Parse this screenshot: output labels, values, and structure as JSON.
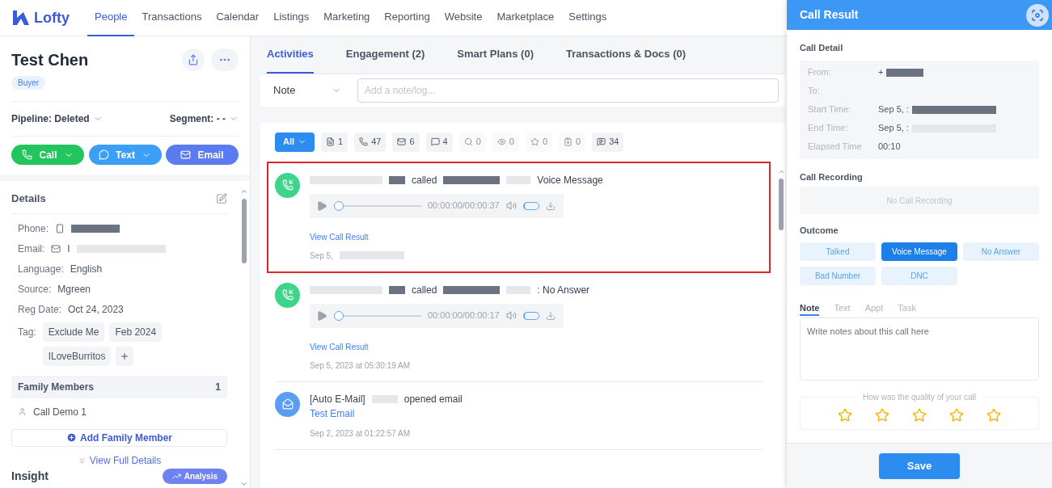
{
  "brand": "Lofty",
  "nav": [
    {
      "label": "People",
      "selected": true
    },
    {
      "label": "Transactions",
      "selected": false
    },
    {
      "label": "Calendar",
      "selected": false
    },
    {
      "label": "Listings",
      "selected": false
    },
    {
      "label": "Marketing",
      "selected": false
    },
    {
      "label": "Reporting",
      "selected": false
    },
    {
      "label": "Website",
      "selected": false
    },
    {
      "label": "Marketplace",
      "selected": false
    },
    {
      "label": "Settings",
      "selected": false
    }
  ],
  "contact": {
    "name": "Test Chen",
    "badge": "Buyer",
    "pipeline": "Pipeline: Deleted",
    "segment": "Segment: - -",
    "actions": [
      {
        "label": "Call",
        "kind": "call"
      },
      {
        "label": "Text",
        "kind": "text"
      },
      {
        "label": "Email",
        "kind": "email"
      }
    ]
  },
  "details": {
    "title": "Details",
    "fields": [
      {
        "label": "Phone:",
        "kind": "phone"
      },
      {
        "label": "Email:",
        "kind": "email",
        "value": "I"
      },
      {
        "label": "Language:",
        "kind": "plain",
        "value": "English"
      },
      {
        "label": "Source:",
        "kind": "plain",
        "value": "Mgreen"
      },
      {
        "label": "Reg Date:",
        "kind": "plain",
        "value": "Oct 24, 2023"
      }
    ],
    "tag_label": "Tag:",
    "tags": [
      "Exclude Me",
      "Feb 2024",
      "ILoveBurritos"
    ],
    "family_title": "Family Members",
    "family_count": "1",
    "family": [
      "Call Demo 1"
    ],
    "add_family": "Add Family Member",
    "view_full": "View Full Details"
  },
  "insight": {
    "title": "Insight",
    "button": "Analysis"
  },
  "tabs": [
    {
      "label": "Activities",
      "selected": true
    },
    {
      "label": "Engagement (2)",
      "selected": false
    },
    {
      "label": "Smart Plans (0)",
      "selected": false
    },
    {
      "label": "Transactions & Docs (0)",
      "selected": false
    }
  ],
  "note_bar": {
    "type": "Note",
    "placeholder": "Add a note/log..."
  },
  "filters": [
    {
      "kind": "all",
      "label": "All",
      "selected": true
    },
    {
      "kind": "note",
      "label": "1",
      "selected": false,
      "disabled": false
    },
    {
      "kind": "call",
      "label": "47",
      "selected": false,
      "disabled": false
    },
    {
      "kind": "email",
      "label": "6",
      "selected": false,
      "disabled": false
    },
    {
      "kind": "text",
      "label": "4",
      "selected": false,
      "disabled": false
    },
    {
      "kind": "search",
      "label": "0",
      "selected": false,
      "disabled": true
    },
    {
      "kind": "view",
      "label": "0",
      "selected": false,
      "disabled": true
    },
    {
      "kind": "favorite",
      "label": "0",
      "selected": false,
      "disabled": true
    },
    {
      "kind": "task",
      "label": "0",
      "selected": false,
      "disabled": true
    },
    {
      "kind": "chat",
      "label": "34",
      "selected": false,
      "disabled": false
    }
  ],
  "activities": [
    {
      "kind": "call",
      "highlighted": true,
      "verb": "called",
      "outcome": "Voice Message",
      "time": "00:00:00/00:00:37",
      "link": "View Call Result",
      "date": "Sep 5,",
      "level": 0
    },
    {
      "kind": "call",
      "highlighted": false,
      "verb": "called",
      "outcome": ": No Answer",
      "time": "00:00:00/00:00:17",
      "link": "View Call Result",
      "date": "Sep 5, 2023 at 05:30:19 AM",
      "level": 0
    },
    {
      "kind": "email",
      "highlighted": false,
      "prefix": "[Auto E-Mail]",
      "verb": "opened email",
      "link": "Test Email",
      "date": "Sep 2, 2023 at 01:22:57 AM"
    }
  ],
  "call_result": {
    "title": "Call Result",
    "detail_title": "Call Detail",
    "detail": [
      {
        "label": "From:",
        "value": "+"
      },
      {
        "label": "To:"
      },
      {
        "label": "Start Time:",
        "value": "Sep 5, :"
      },
      {
        "label": "End Time:",
        "value": "Sep 5, :"
      },
      {
        "label": "Elapsed Time",
        "value": "00:10"
      }
    ],
    "recording_title": "Call Recording",
    "recording": "No Call Recording",
    "outcome_title": "Outcome",
    "outcomes": [
      {
        "label": "Talked",
        "selected": false
      },
      {
        "label": "Voice Message",
        "selected": true
      },
      {
        "label": "No Answer",
        "selected": false
      },
      {
        "label": "Bad Number",
        "selected": false
      },
      {
        "label": "DNC",
        "selected": false
      }
    ],
    "note_tabs": [
      {
        "label": "Note",
        "selected": true
      },
      {
        "label": "Text",
        "selected": false
      },
      {
        "label": "Appt",
        "selected": false
      },
      {
        "label": "Task",
        "selected": false
      }
    ],
    "note_placeholder": "Write notes about this call here",
    "quality": "How was the quality of your call",
    "stars": 0,
    "save": "Save"
  }
}
